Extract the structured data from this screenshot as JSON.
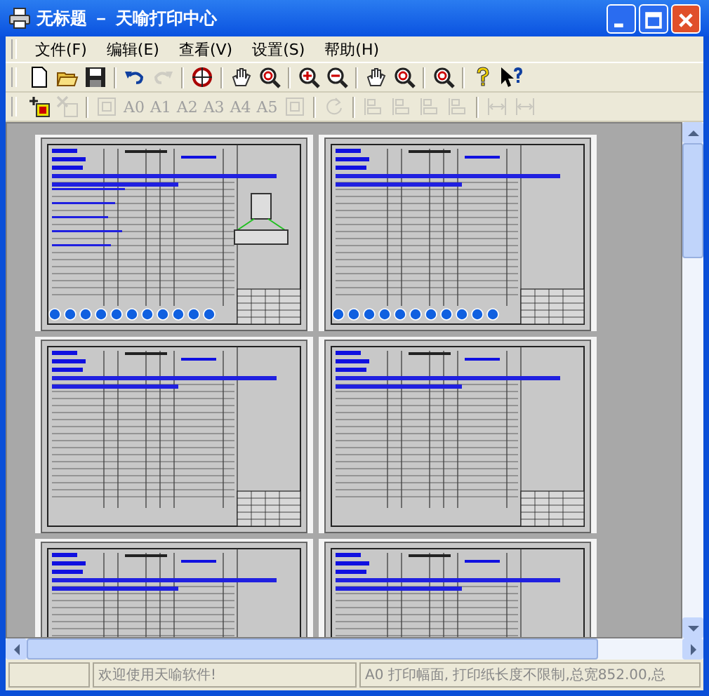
{
  "window": {
    "title": "无标题 － 天喻打印中心"
  },
  "menu": [
    {
      "label": "文件(F)"
    },
    {
      "label": "编辑(E)"
    },
    {
      "label": "查看(V)"
    },
    {
      "label": "设置(S)"
    },
    {
      "label": "帮助(H)"
    }
  ],
  "toolbar_1": [
    {
      "kind": "icon",
      "disabled": false
    },
    {
      "kind": "icon",
      "disabled": false
    },
    {
      "kind": "icon",
      "disabled": false
    },
    {
      "kind": "sep"
    },
    {
      "kind": "icon",
      "disabled": false
    },
    {
      "kind": "icon",
      "disabled": true
    },
    {
      "kind": "sep"
    },
    {
      "kind": "icon",
      "disabled": false
    },
    {
      "kind": "sep"
    },
    {
      "kind": "icon",
      "disabled": false
    },
    {
      "kind": "icon",
      "disabled": false
    },
    {
      "kind": "sep"
    },
    {
      "kind": "icon",
      "disabled": false
    },
    {
      "kind": "icon",
      "disabled": false
    },
    {
      "kind": "sep"
    },
    {
      "kind": "icon",
      "disabled": false
    },
    {
      "kind": "icon",
      "disabled": false
    },
    {
      "kind": "sep"
    },
    {
      "kind": "icon",
      "disabled": false
    },
    {
      "kind": "sep"
    },
    {
      "kind": "icon",
      "disabled": false
    },
    {
      "kind": "icon",
      "disabled": false
    }
  ],
  "toolbar_2": [
    {
      "kind": "icon",
      "disabled": false
    },
    {
      "kind": "icon",
      "disabled": true
    },
    {
      "kind": "sep"
    },
    {
      "kind": "icon",
      "disabled": true
    },
    {
      "kind": "text",
      "label": "A0",
      "disabled": true
    },
    {
      "kind": "text",
      "label": "A1",
      "disabled": true
    },
    {
      "kind": "text",
      "label": "A2",
      "disabled": true
    },
    {
      "kind": "text",
      "label": "A3",
      "disabled": true
    },
    {
      "kind": "text",
      "label": "A4",
      "disabled": true
    },
    {
      "kind": "text",
      "label": "A5",
      "disabled": true
    },
    {
      "kind": "icon",
      "disabled": true
    },
    {
      "kind": "sep"
    },
    {
      "kind": "icon",
      "disabled": true
    },
    {
      "kind": "sep"
    },
    {
      "kind": "icon",
      "disabled": true
    },
    {
      "kind": "icon",
      "disabled": true
    },
    {
      "kind": "icon",
      "disabled": true
    },
    {
      "kind": "icon",
      "disabled": true
    },
    {
      "kind": "sep"
    },
    {
      "kind": "icon",
      "disabled": true
    },
    {
      "kind": "icon",
      "disabled": true
    }
  ],
  "pages": [
    {
      "kind": "diagram"
    },
    {
      "kind": "sheet"
    },
    {
      "kind": "sheet"
    },
    {
      "kind": "sheet"
    },
    {
      "kind": "sheet"
    },
    {
      "kind": "sheet"
    }
  ],
  "status_bar": {
    "message": "欢迎使用天喻软件!",
    "info": "A0 打印幅面, 打印纸长度不限制,总宽852.00,总"
  }
}
